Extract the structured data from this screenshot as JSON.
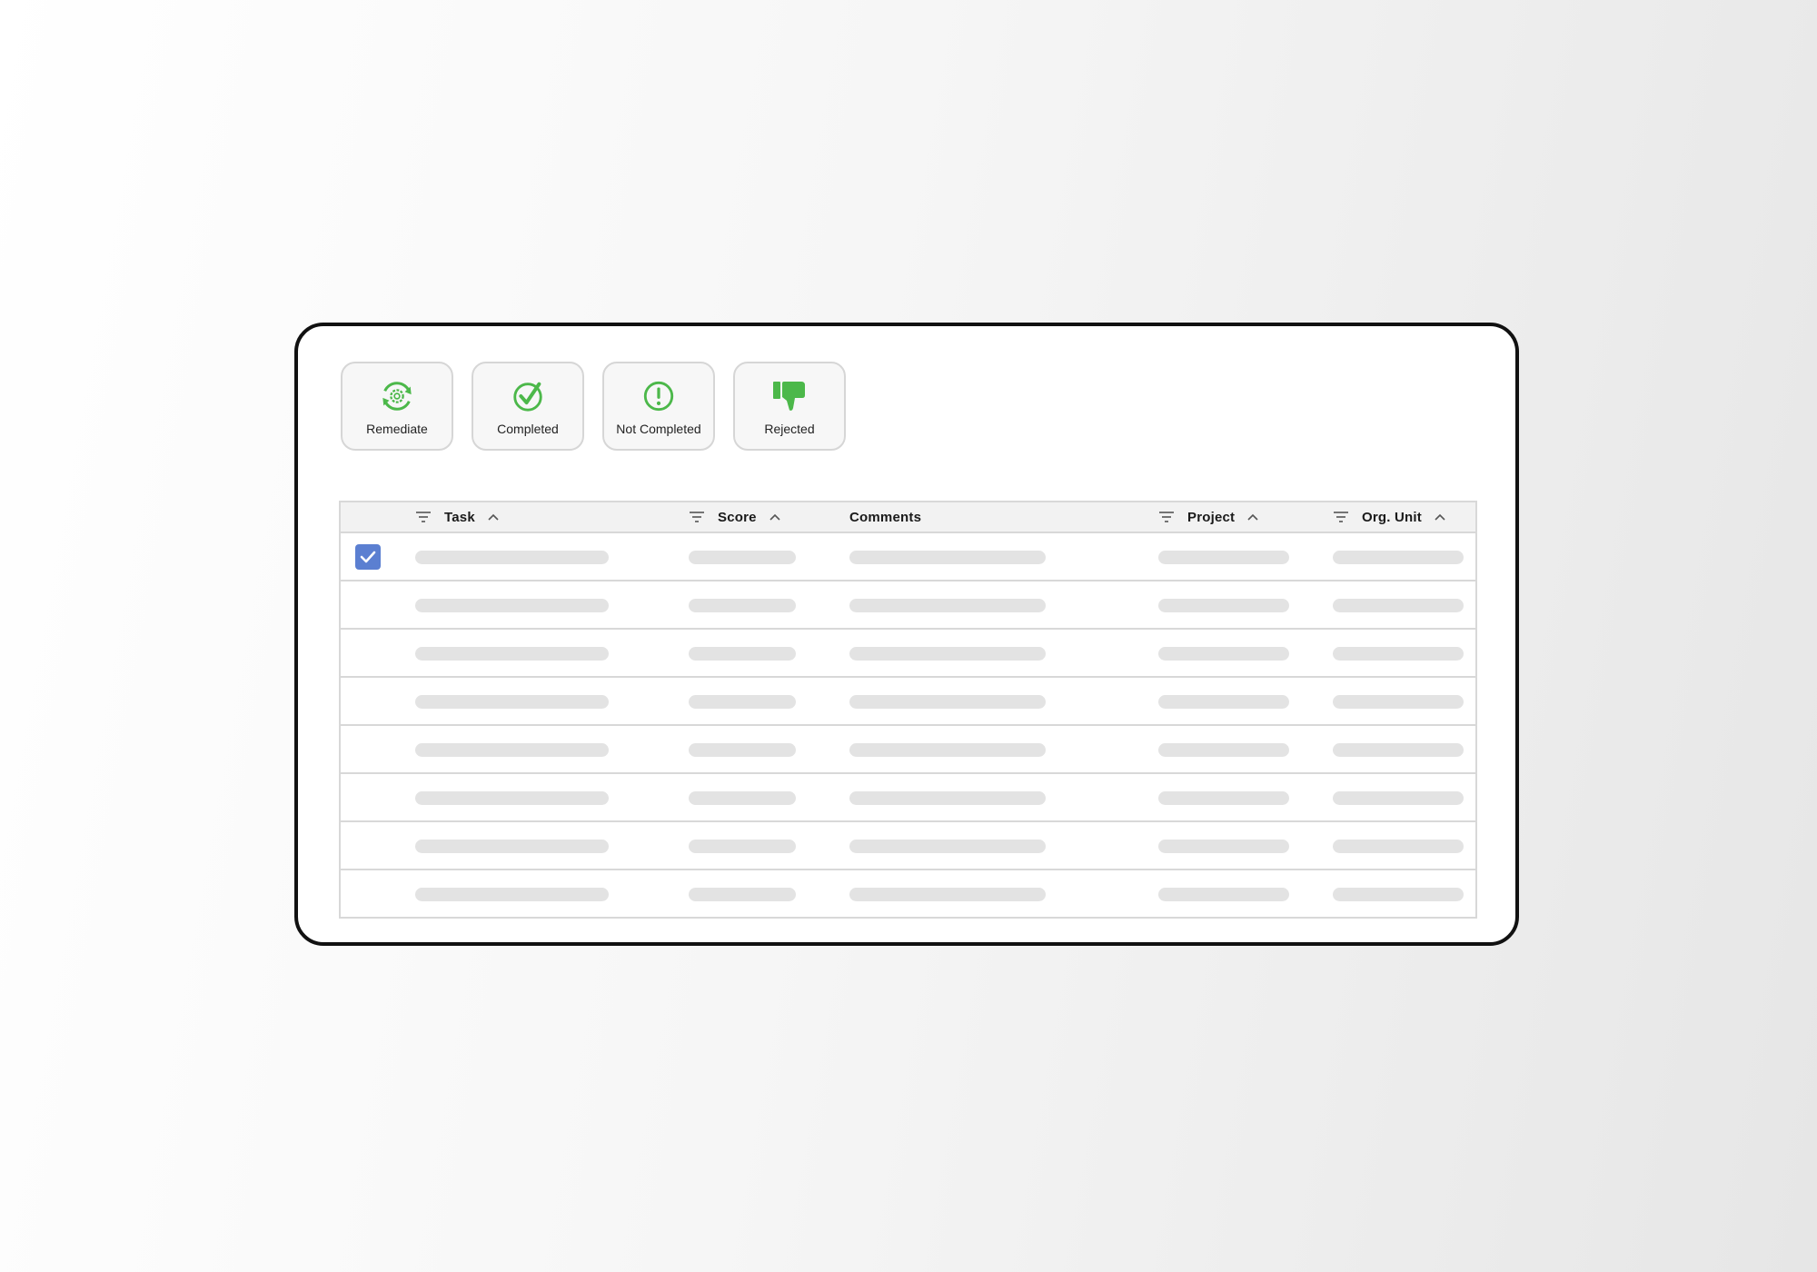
{
  "actions": [
    {
      "label": "Remediate",
      "icon": "refresh-gear-icon"
    },
    {
      "label": "Completed",
      "icon": "check-circle-icon"
    },
    {
      "label": "Not Completed",
      "icon": "exclamation-circle-icon"
    },
    {
      "label": "Rejected",
      "icon": "thumbs-down-icon"
    }
  ],
  "colors": {
    "accent_green": "#4cb84a",
    "checkbox_blue": "#5b7fd1"
  },
  "table": {
    "columns": {
      "task": "Task",
      "score": "Score",
      "comments": "Comments",
      "project": "Project",
      "org_unit": "Org. Unit"
    },
    "rows": [
      {
        "selected": true
      },
      {
        "selected": false
      },
      {
        "selected": false
      },
      {
        "selected": false
      },
      {
        "selected": false
      },
      {
        "selected": false
      },
      {
        "selected": false
      },
      {
        "selected": false
      }
    ]
  }
}
